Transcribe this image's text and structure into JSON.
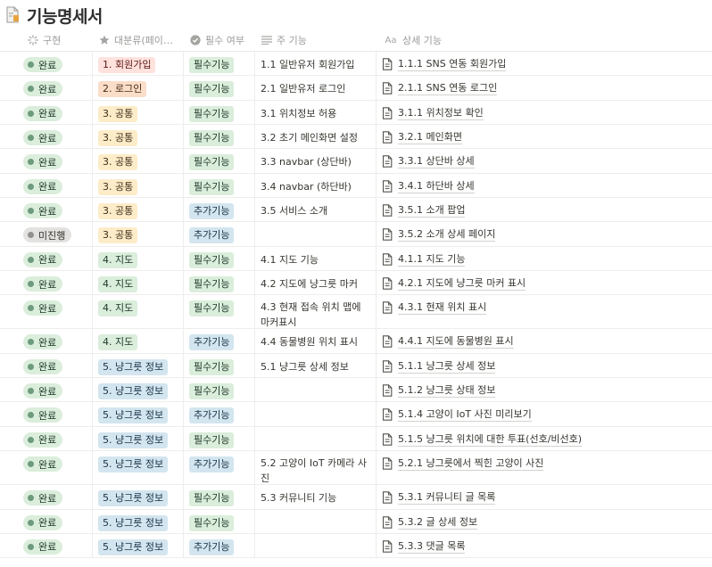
{
  "page": {
    "title": "기능명세서",
    "icon": "page-icon"
  },
  "columns": {
    "status": {
      "label": "구현",
      "icon": "loading-icon"
    },
    "category": {
      "label": "대분류(페이…",
      "icon": "star-icon"
    },
    "required": {
      "label": "필수 여부",
      "icon": "check-circle-icon"
    },
    "main": {
      "label": "주 기능",
      "icon": "text-lines-icon"
    },
    "detail": {
      "label": "상세 기능",
      "icon": "text-aa-icon"
    }
  },
  "colors": {
    "done": "#dbeddb",
    "todo": "#e3e2e0",
    "red": "#ffe2dd",
    "orange": "#fadec9",
    "yellow": "#fdecc8",
    "green": "#dbeddb",
    "blue": "#d3e5ef"
  },
  "rows": [
    {
      "status": "완료",
      "category": "1. 회원가입",
      "required": "필수기능",
      "main": "1.1 일반유저 회원가입",
      "detail": "1.1.1 SNS 연동 회원가입"
    },
    {
      "status": "완료",
      "category": "2. 로그인",
      "required": "필수기능",
      "main": "2.1 일반유저 로그인",
      "detail": "2.1.1 SNS 연동 로그인"
    },
    {
      "status": "완료",
      "category": "3. 공통",
      "required": "필수기능",
      "main": "3.1 위치정보 허용",
      "detail": "3.1.1 위치정보 확인"
    },
    {
      "status": "완료",
      "category": "3. 공통",
      "required": "필수기능",
      "main": "3.2 초기 메인화면 설정",
      "detail": "3.2.1 메인화면"
    },
    {
      "status": "완료",
      "category": "3. 공통",
      "required": "필수기능",
      "main": "3.3 navbar (상단바)",
      "detail": "3.3.1 상단바 상세"
    },
    {
      "status": "완료",
      "category": "3. 공통",
      "required": "필수기능",
      "main": "3.4 navbar (하단바)",
      "detail": "3.4.1 하단바 상세"
    },
    {
      "status": "완료",
      "category": "3. 공통",
      "required": "추가기능",
      "main": "3.5 서비스 소개",
      "detail": "3.5.1 소개 팝업"
    },
    {
      "status": "미진행",
      "category": "3. 공통",
      "required": "추가기능",
      "main": "",
      "detail": "3.5.2 소개 상세 페이지"
    },
    {
      "status": "완료",
      "category": "4. 지도",
      "required": "필수기능",
      "main": "4.1 지도 기능",
      "detail": "4.1.1 지도 기능"
    },
    {
      "status": "완료",
      "category": "4. 지도",
      "required": "필수기능",
      "main": "4.2 지도에 냥그릇 마커",
      "detail": "4.2.1 지도에 냥그릇 마커 표시"
    },
    {
      "status": "완료",
      "category": "4. 지도",
      "required": "필수기능",
      "main": "4.3 현재 접속 위치 맵에 마커표시",
      "detail": "4.3.1 현재 위치 표시"
    },
    {
      "status": "완료",
      "category": "4. 지도",
      "required": "추가기능",
      "main": "4.4 동물병원 위치 표시",
      "detail": "4.4.1 지도에 동물병원 표시"
    },
    {
      "status": "완료",
      "category": "5. 냥그릇 정보",
      "required": "필수기능",
      "main": "5.1 냥그릇 상세 정보",
      "detail": "5.1.1 냥그릇 상세 정보"
    },
    {
      "status": "완료",
      "category": "5. 냥그릇 정보",
      "required": "필수기능",
      "main": "",
      "detail": "5.1.2 냥그릇 상태 정보"
    },
    {
      "status": "완료",
      "category": "5. 냥그릇 정보",
      "required": "추가기능",
      "main": "",
      "detail": "5.1.4 고양이 IoT 사진 미리보기"
    },
    {
      "status": "완료",
      "category": "5. 냥그릇 정보",
      "required": "필수기능",
      "main": "",
      "detail": "5.1.5 냥그릇 위치에 대한 투표(선호/비선호)"
    },
    {
      "status": "완료",
      "category": "5. 냥그릇 정보",
      "required": "추가기능",
      "main": "5.2 고양이 IoT 카메라 사진",
      "detail": "5.2.1 냥그릇에서 찍힌 고양이 사진"
    },
    {
      "status": "완료",
      "category": "5. 냥그릇 정보",
      "required": "필수기능",
      "main": "5.3 커뮤니티 기능",
      "detail": "5.3.1 커뮤니티 글 목록"
    },
    {
      "status": "완료",
      "category": "5. 냥그릇 정보",
      "required": "필수기능",
      "main": "",
      "detail": "5.3.2 글 상세 정보"
    },
    {
      "status": "완료",
      "category": "5. 냥그릇 정보",
      "required": "추가기능",
      "main": "",
      "detail": "5.3.3 댓글 목록"
    }
  ]
}
